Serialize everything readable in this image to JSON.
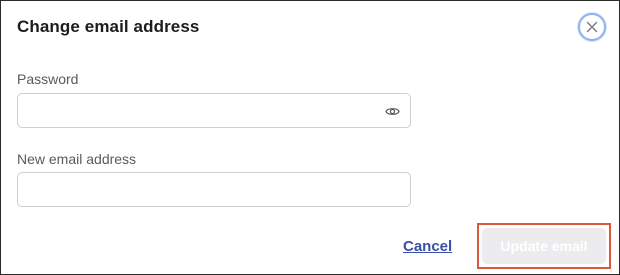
{
  "dialog": {
    "title": "Change email address",
    "close_icon": "close-icon",
    "password": {
      "label": "Password",
      "value": "",
      "placeholder": "",
      "reveal_icon": "eye-icon"
    },
    "new_email": {
      "label": "New email address",
      "value": "",
      "placeholder": ""
    },
    "cancel_label": "Cancel",
    "update_label": "Update email",
    "update_enabled": false
  },
  "colors": {
    "accent_link": "#3a4fa8",
    "focus_ring": "#8fb3ee",
    "highlight_box": "#d9593a",
    "disabled_button_bg": "#ececee"
  }
}
